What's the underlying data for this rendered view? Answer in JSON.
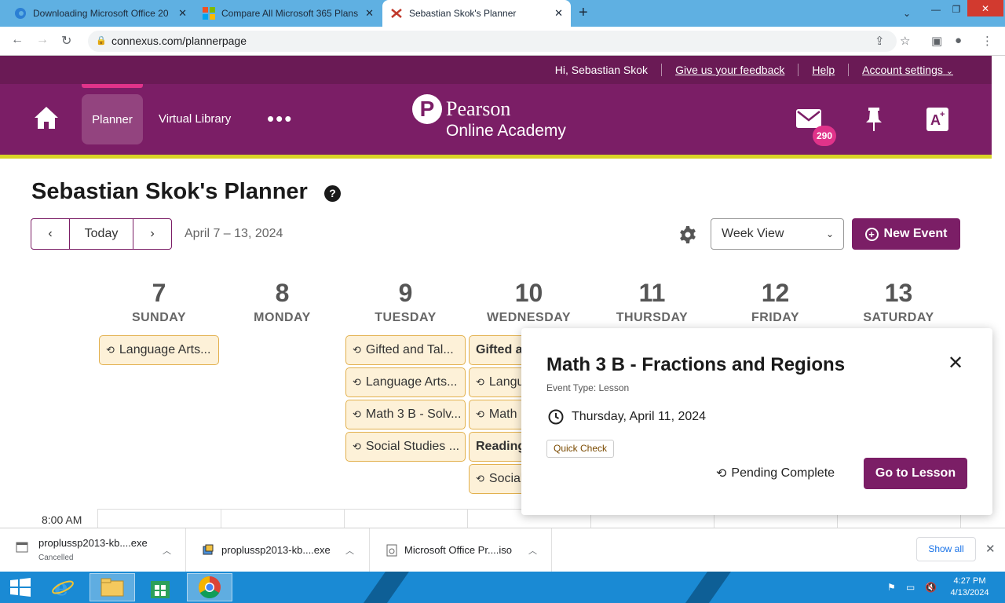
{
  "browser": {
    "tabs": [
      {
        "title": "Downloading Microsoft Office 20",
        "active": false
      },
      {
        "title": "Compare All Microsoft 365 Plans",
        "active": false
      },
      {
        "title": "Sebastian Skok's Planner",
        "active": true
      }
    ],
    "url": "connexus.com/plannerpage"
  },
  "header": {
    "greeting": "Hi, Sebastian Skok",
    "feedback": "Give us your feedback",
    "help": "Help",
    "account": "Account settings",
    "nav_planner": "Planner",
    "nav_library": "Virtual Library",
    "logo_line1": "Pearson",
    "logo_line2": "Online Academy",
    "mail_count": "290"
  },
  "planner": {
    "title": "Sebastian Skok's Planner",
    "today": "Today",
    "date_range": "April 7 – 13, 2024",
    "view": "Week View",
    "new_event": "New Event",
    "days": [
      {
        "num": "7",
        "name": "SUNDAY"
      },
      {
        "num": "8",
        "name": "MONDAY"
      },
      {
        "num": "9",
        "name": "TUESDAY"
      },
      {
        "num": "10",
        "name": "WEDNESDAY"
      },
      {
        "num": "11",
        "name": "THURSDAY"
      },
      {
        "num": "12",
        "name": "FRIDAY"
      },
      {
        "num": "13",
        "name": "SATURDAY"
      }
    ],
    "events": {
      "sun": [
        "Language Arts..."
      ],
      "tue": [
        "Gifted and Tal...",
        "Language Arts...",
        "Math 3 B - Solv...",
        "Social Studies ..."
      ],
      "wed": [
        "Gifted a",
        "Langu",
        "Math",
        "Reading",
        "Social"
      ]
    },
    "time_label": "8:00 AM"
  },
  "popup": {
    "title": "Math 3 B - Fractions and Regions",
    "event_type": "Event Type: Lesson",
    "date": "Thursday, April 11, 2024",
    "tag": "Quick Check",
    "status": "Pending Complete",
    "button": "Go to Lesson"
  },
  "downloads": [
    {
      "name": "proplussp2013-kb....exe",
      "status": "Cancelled"
    },
    {
      "name": "proplussp2013-kb....exe",
      "status": ""
    },
    {
      "name": "Microsoft Office Pr....iso",
      "status": ""
    }
  ],
  "downloads_show_all": "Show all",
  "taskbar": {
    "time": "4:27 PM",
    "date": "4/13/2024"
  },
  "colors": {
    "brand": "#7b1e66",
    "accent": "#e0338a",
    "yellow": "#d9d327",
    "event_bg": "#fdf1d8"
  }
}
